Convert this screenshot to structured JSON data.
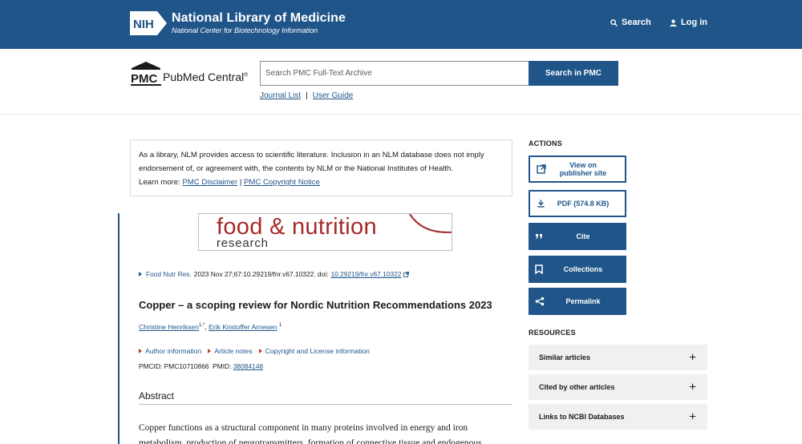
{
  "nih": {
    "logo_text": "NIH",
    "title": "National Library of Medicine",
    "subtitle": "National Center for Biotechnology Information",
    "search_label": "Search",
    "login_label": "Log in"
  },
  "pmc": {
    "logo_text": "PMC",
    "name": "PubMed Central",
    "reg": "®",
    "search_placeholder": "Search PMC Full-Text Archive",
    "search_button": "Search in PMC",
    "journal_list": "Journal List",
    "separator": "|",
    "user_guide": "User Guide"
  },
  "disclaimer": {
    "text": "As a library, NLM provides access to scientific literature. Inclusion in an NLM database does not imply endorsement of, or agreement with, the contents by NLM or the National Institutes of Health.",
    "learn_more": "Learn more:",
    "link1": "PMC Disclaimer",
    "sep": "|",
    "link2": "PMC Copyright Notice"
  },
  "journal": {
    "logo_line1": "food & nutrition",
    "logo_line2": "research"
  },
  "citation": {
    "journal": "Food Nutr Res.",
    "details": "2023 Nov 27;67:10.29219/fnr.v67.10322. doi:",
    "doi": "10.29219/fnr.v67.10322"
  },
  "article": {
    "title": "Copper – a scoping review for Nordic Nutrition Recommendations 2023",
    "author1": "Christine Henriksen",
    "author1_sup": "1,*",
    "comma": ",",
    "author2": "Erik Kristoffer Arnesen",
    "author2_sup": "1",
    "author_info": "Author information",
    "article_notes": "Article notes",
    "copyright": "Copyright and License information",
    "pmcid_label": "PMCID: PMC10710866",
    "pmid_label": "PMID:",
    "pmid": "38084148",
    "abstract_heading": "Abstract",
    "abstract_text": "Copper functions as a structural component in many proteins involved in energy and iron metabolism, production of neurotransmitters, formation of connective tissue and endogenous"
  },
  "sidebar": {
    "actions_heading": "ACTIONS",
    "view_publisher_line1": "View on",
    "view_publisher_line2": "publisher site",
    "pdf": "PDF (574.8 KB)",
    "cite": "Cite",
    "collections": "Collections",
    "permalink": "Permalink",
    "resources_heading": "RESOURCES",
    "resources": [
      "Similar articles",
      "Cited by other articles",
      "Links to NCBI Databases"
    ],
    "plus": "+"
  },
  "colors": {
    "nih_blue": "#20558a",
    "journal_red": "#a52a2a",
    "resource_bg": "#f0f0f0"
  }
}
